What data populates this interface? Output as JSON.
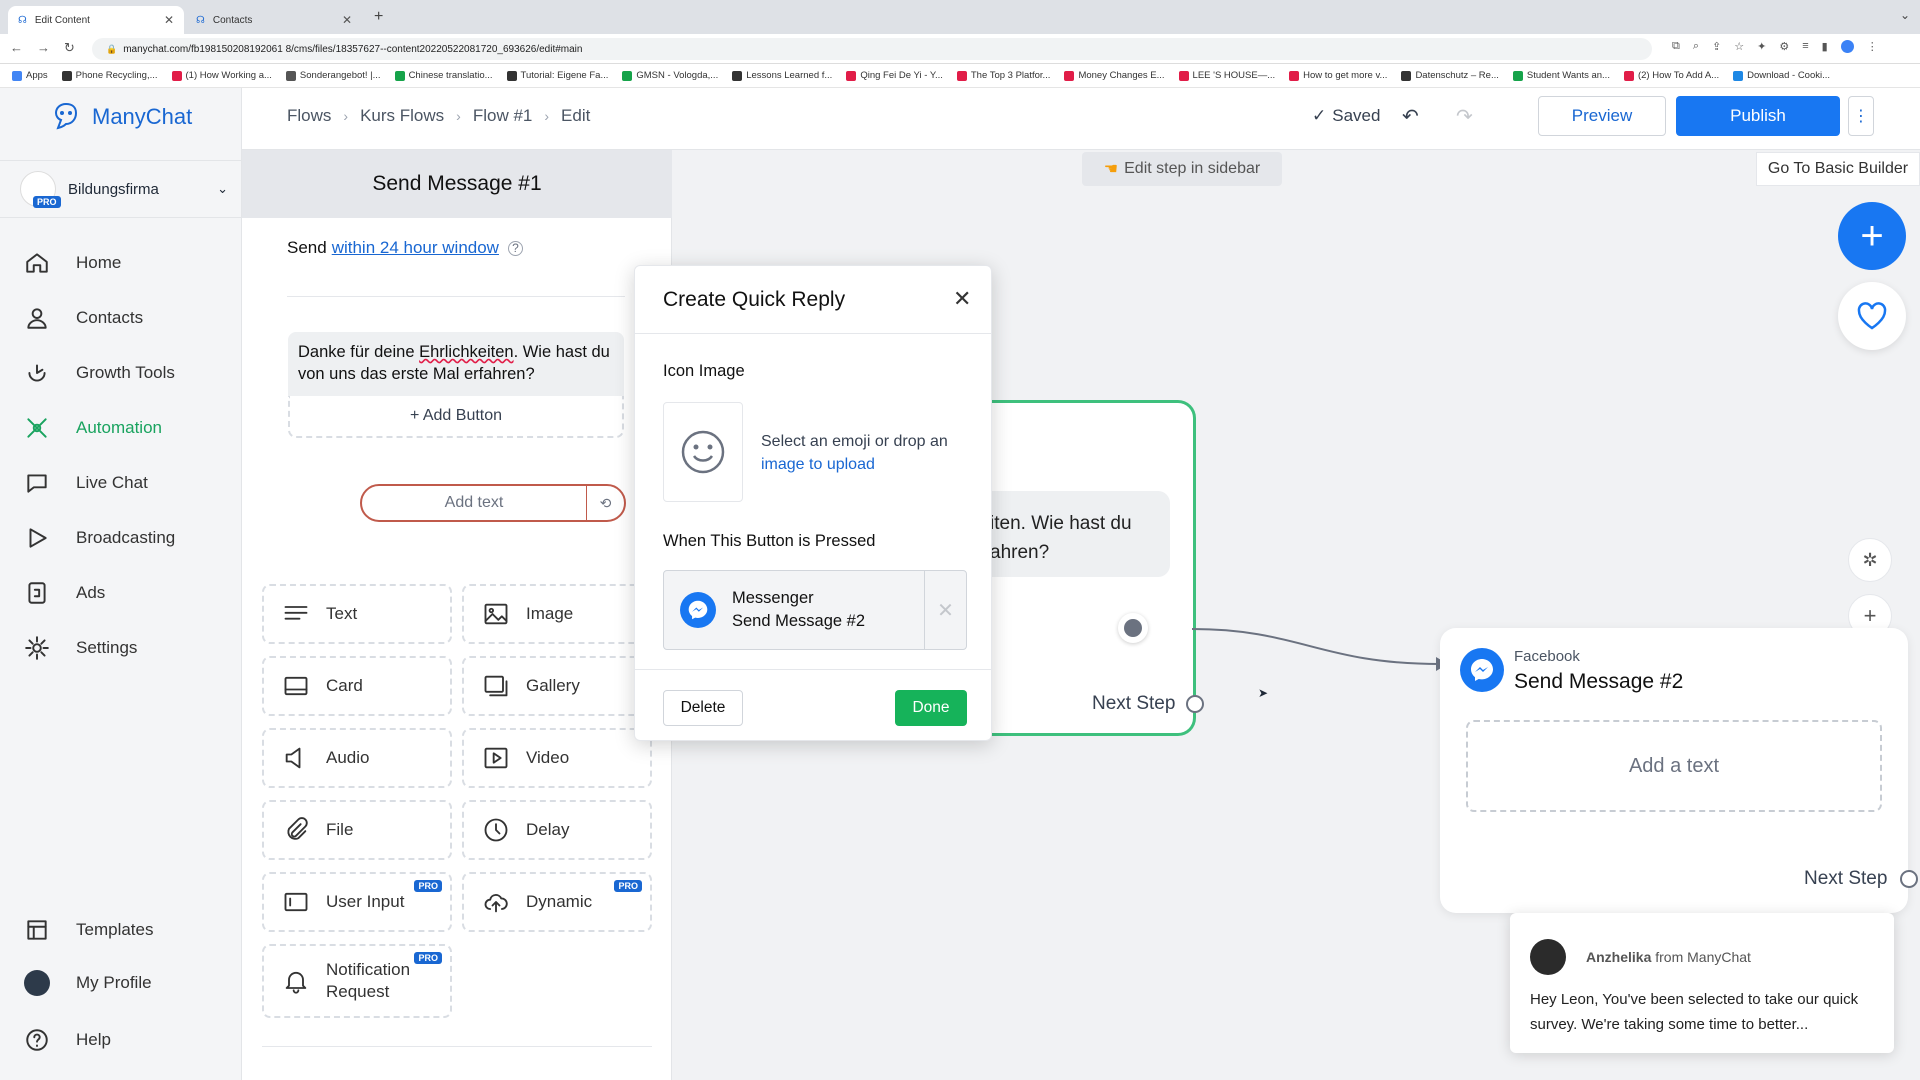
{
  "browser": {
    "tabs": [
      {
        "label": "Edit Content",
        "active": true
      },
      {
        "label": "Contacts",
        "active": false
      }
    ],
    "url": "manychat.com/fb198150208192061 8/cms/files/18357627--content20220522081720_693626/edit#main",
    "bookmarks": [
      "Apps",
      "Phone Recycling,...",
      "(1) How Working a...",
      "Sonderangebot! |...",
      "Chinese translatio...",
      "Tutorial: Eigene Fa...",
      "GMSN - Vologda,...",
      "Lessons Learned f...",
      "Qing Fei De Yi - Y...",
      "The Top 3 Platfor...",
      "Money Changes E...",
      "LEE 'S HOUSE—...",
      "How to get more v...",
      "Datenschutz – Re...",
      "Student Wants an...",
      "(2) How To Add A...",
      "Download - Cooki..."
    ]
  },
  "app": {
    "logo_text": "ManyChat",
    "account": {
      "name": "Bildungsfirma",
      "badge": "PRO"
    },
    "nav": [
      {
        "label": "Home",
        "icon": "home-icon"
      },
      {
        "label": "Contacts",
        "icon": "user-icon"
      },
      {
        "label": "Growth Tools",
        "icon": "growth-icon"
      },
      {
        "label": "Automation",
        "icon": "automation-icon",
        "active": true
      },
      {
        "label": "Live Chat",
        "icon": "chat-icon"
      },
      {
        "label": "Broadcasting",
        "icon": "broadcast-icon"
      },
      {
        "label": "Ads",
        "icon": "ads-icon"
      },
      {
        "label": "Settings",
        "icon": "gear-icon"
      }
    ],
    "nav_bottom": [
      {
        "label": "Templates",
        "icon": "templates-icon"
      },
      {
        "label": "My Profile",
        "icon": "avatar"
      },
      {
        "label": "Help",
        "icon": "help-icon"
      }
    ]
  },
  "header": {
    "breadcrumb": [
      "Flows",
      "Kurs Flows",
      "Flow #1",
      "Edit"
    ],
    "saved": "Saved",
    "preview": "Preview",
    "publish": "Publish"
  },
  "panel": {
    "title": "Send Message #1",
    "send_prefix": "Send",
    "send_link": "within 24 hour window",
    "message_text_a": "Danke für deine",
    "message_text_b": "Ehrlichkeiten",
    "message_text_c": ". Wie hast du von uns das erste Mal erfahren?",
    "add_button": "+ Add Button",
    "add_text_placeholder": "Add text",
    "elements": [
      {
        "label": "Text",
        "icon": "text-icon"
      },
      {
        "label": "Image",
        "icon": "image-icon"
      },
      {
        "label": "Card",
        "icon": "card-icon"
      },
      {
        "label": "Gallery",
        "icon": "gallery-icon"
      },
      {
        "label": "Audio",
        "icon": "audio-icon"
      },
      {
        "label": "Video",
        "icon": "video-icon"
      },
      {
        "label": "File",
        "icon": "file-icon"
      },
      {
        "label": "Delay",
        "icon": "clock-icon"
      },
      {
        "label": "User Input",
        "icon": "input-icon",
        "pro": "PRO"
      },
      {
        "label": "Dynamic",
        "icon": "cloud-icon",
        "pro": "PRO"
      },
      {
        "label": "Notification Request",
        "icon": "bell-icon",
        "pro": "PRO"
      }
    ]
  },
  "canvas": {
    "hint": "Edit step in sidebar",
    "basic_builder": "Go To Basic Builder",
    "node1_text_a": "iten. Wie hast du",
    "node1_text_b": "ahren?",
    "node1_next": "Next Step",
    "node2_platform": "Facebook",
    "node2_title": "Send Message #2",
    "node2_add_text": "Add a text",
    "node2_next": "Next Step"
  },
  "modal": {
    "title": "Create Quick Reply",
    "icon_section": "Icon Image",
    "icon_hint": "Select an emoji or drop an",
    "icon_link": "image to upload",
    "pressed_section": "When This Button is Pressed",
    "action_title": "Messenger",
    "action_sub": "Send Message #2",
    "delete": "Delete",
    "done": "Done"
  },
  "chat_popup": {
    "sender": "Anzhelika",
    "from": "from ManyChat",
    "message": "Hey Leon,  You've been selected to take our quick survey. We're taking some time to better..."
  },
  "colors": {
    "brand": "#1967d2",
    "green": "#19a35f",
    "done": "#16b35a",
    "messenger": "#1877f2"
  }
}
